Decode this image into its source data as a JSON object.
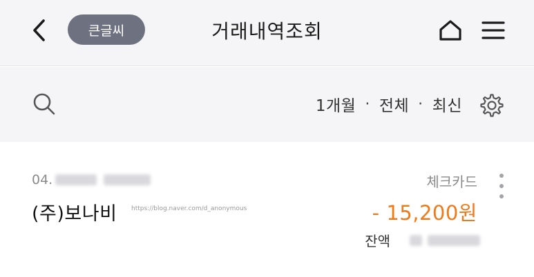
{
  "header": {
    "big_font_label": "큰글씨",
    "title": "거래내역조회",
    "back_icon": "chevron-left-icon",
    "home_icon": "home-icon",
    "menu_icon": "hamburger-menu-icon"
  },
  "filter": {
    "search_icon": "search-icon",
    "period": "1개월",
    "kind": "전체",
    "order": "최신",
    "settings_icon": "gear-icon"
  },
  "transactions": [
    {
      "date_visible": "04.",
      "merchant": "(주)보나비",
      "watermark": "https://blog.naver.com/d_anonymous",
      "type": "체크카드",
      "amount": "- 15,200원",
      "balance_label": "잔액"
    }
  ],
  "colors": {
    "accent_amount": "#f07a1a",
    "header_bg": "#f5f5f7",
    "pill_bg": "#6e7280"
  }
}
